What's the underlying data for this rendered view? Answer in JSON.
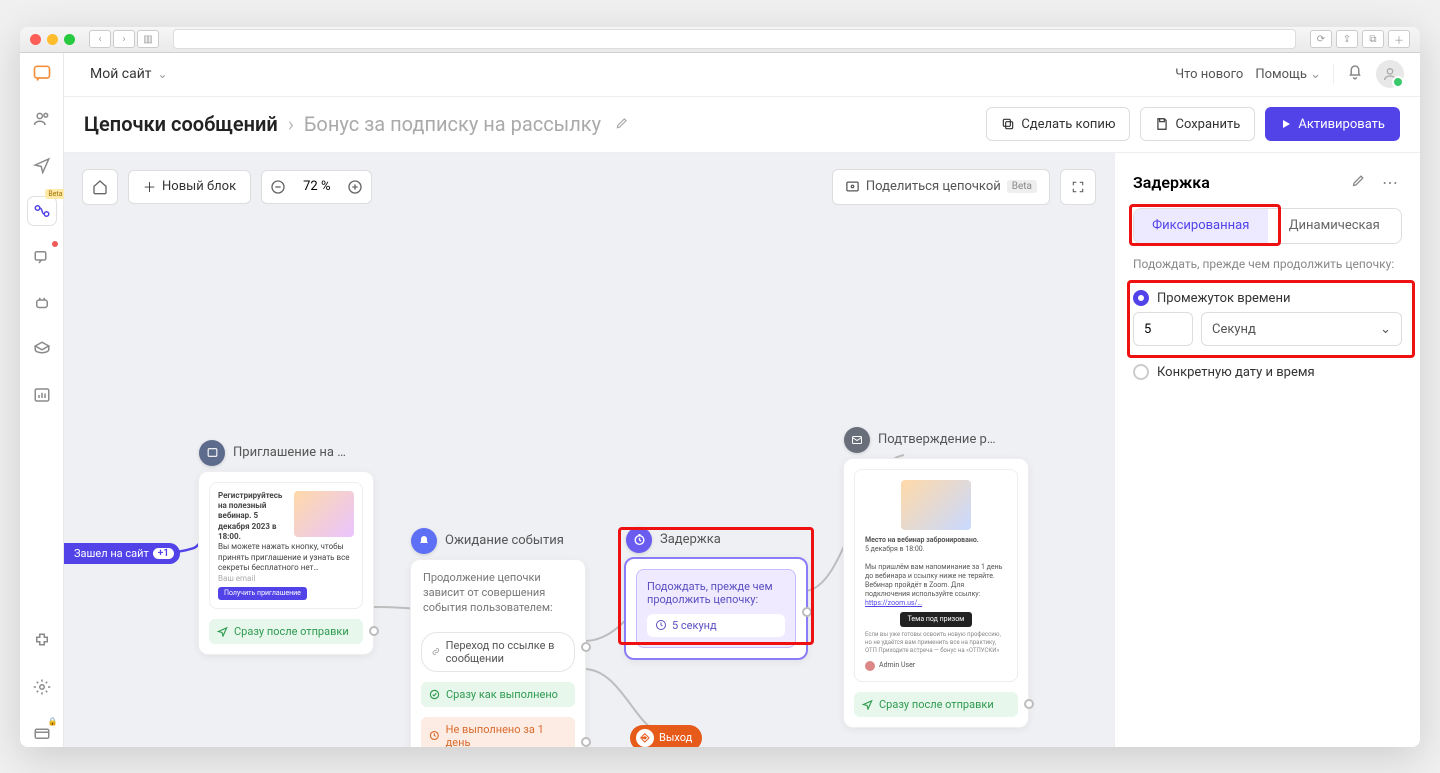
{
  "topbar": {
    "site": "Мой сайт",
    "whatsnew": "Что нового",
    "help": "Помощь"
  },
  "breadcrumb": {
    "root": "Цепочки сообщений",
    "current": "Бонус за подписку на рассылку",
    "copy_btn": "Сделать копию",
    "save_btn": "Сохранить",
    "activate_btn": "Активировать"
  },
  "canvas": {
    "new_block": "Новый блок",
    "zoom": "72 %",
    "share": "Поделиться цепочкой",
    "beta": "Beta",
    "trigger": "Зашел на сайт",
    "trigger_plus": "+1"
  },
  "nodes": {
    "n1_title": "Приглашение на …",
    "n1_status": "Сразу после отправки",
    "n1_prev_title": "Регистрируйтесь на полезный вебинар. 5 декабря 2023 в 18:00.",
    "n1_prev_body": "Вы можете нажать кнопку, чтобы принять приглашение и узнать все секреты бесплатного нет…",
    "n1_prev_emailprompt": "Ваш email",
    "n1_prev_cta": "Получить приглашение",
    "n2_title": "Ожидание события",
    "n2_desc": "Продолжение цепочки зависит от совершения события пользователем:",
    "n2_chip": "Переход по ссылке в сообщении",
    "n2_st1": "Сразу как выполнено",
    "n2_st2": "Не выполнено за 1 день",
    "n3_title": "Задержка",
    "n3_desc": "Подождать, прежде чем продолжить цепочку:",
    "n3_time": "5 секунд",
    "exit": "Выход",
    "n4_title": "Подтверждение р…",
    "n4_status": "Сразу после отправки",
    "n4_line1": "Место на вебинар забронировано.",
    "n4_line2": "5 декабря в 18:00.",
    "n4_line3": "Мы пришлём вам напоминание за 1 день до вебинара и ссылку ниже не теряйте. Вебинар пройдёт в Zoom. Для подключения используйте ссылку:",
    "n4_link": "https://zoom.us/…",
    "n4_btn": "Тема под призом",
    "n4_footer": "Если вы уже готовы освоить новую профессию, но не удаётся вам применить все на практику, ОТП Приходите встреча — бонус на «ОТПУСКИ»",
    "n4_author": "Admin User"
  },
  "panel": {
    "title": "Задержка",
    "tab_fixed": "Фиксированная",
    "tab_dyn": "Динамическая",
    "help": "Подождать, прежде чем продолжить цепочку:",
    "opt1": "Промежуток времени",
    "opt2": "Конкретную дату и время",
    "val": "5",
    "unit": "Секунд"
  },
  "leftnav_beta": "Beta"
}
